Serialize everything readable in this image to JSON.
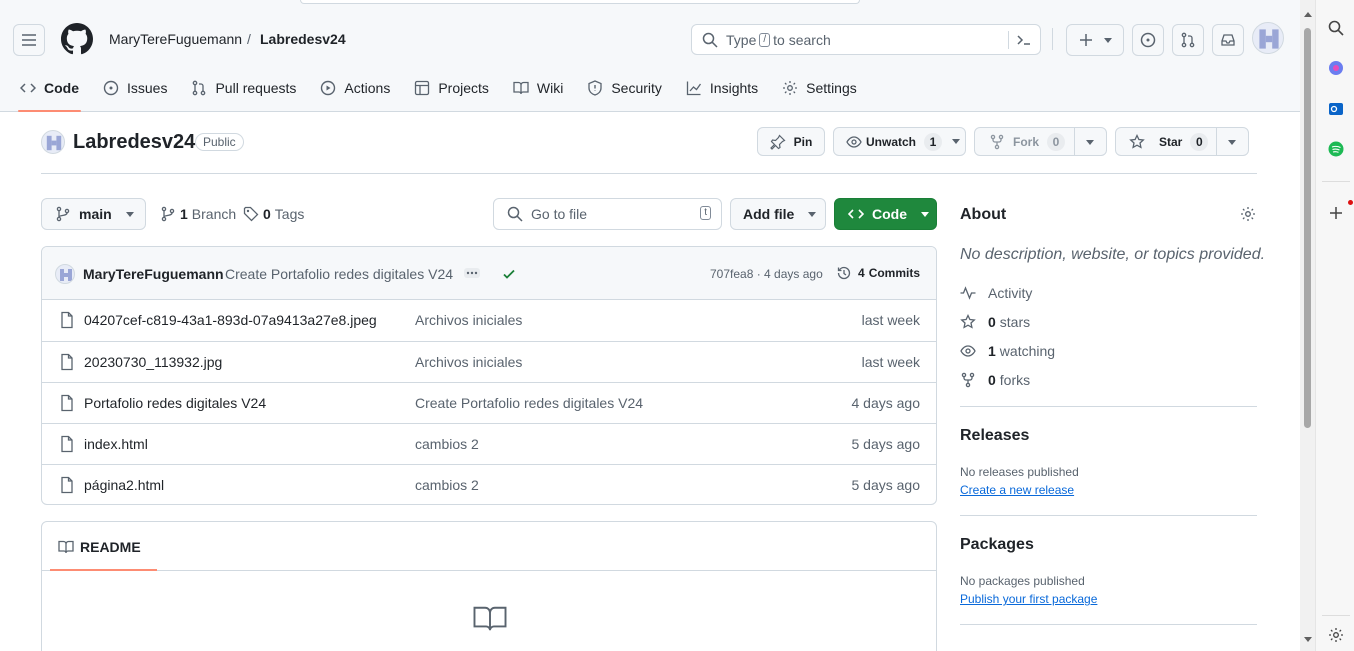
{
  "breadcrumb": {
    "owner": "MaryTereFuguemann",
    "separator": "/",
    "repo": "Labredesv24"
  },
  "search": {
    "type": "Type",
    "key": "/",
    "rest": "to search"
  },
  "nav": [
    {
      "label": "Code",
      "icon": "code-icon",
      "active": true
    },
    {
      "label": "Issues",
      "icon": "issue-icon"
    },
    {
      "label": "Pull requests",
      "icon": "pull-request-icon"
    },
    {
      "label": "Actions",
      "icon": "play-icon"
    },
    {
      "label": "Projects",
      "icon": "table-icon"
    },
    {
      "label": "Wiki",
      "icon": "book-icon"
    },
    {
      "label": "Security",
      "icon": "shield-icon"
    },
    {
      "label": "Insights",
      "icon": "graph-icon"
    },
    {
      "label": "Settings",
      "icon": "gear-icon"
    }
  ],
  "repo": {
    "name": "Labredesv24",
    "visibility": "Public",
    "pin": "Pin",
    "unwatch": "Unwatch",
    "watch_count": "1",
    "fork": "Fork",
    "fork_count": "0",
    "star": "Star",
    "star_count": "0"
  },
  "toolbar": {
    "branch": "main",
    "branches_count": "1",
    "branches_label": "Branch",
    "tags_count": "0",
    "tags_label": "Tags",
    "goto_placeholder": "Go to file",
    "goto_key": "t",
    "add_file": "Add file",
    "code": "Code"
  },
  "commit": {
    "author": "MaryTereFuguemann",
    "message": "Create Portafolio redes digitales V24",
    "sha_time": "707fea8 · 4 days ago",
    "commits_count": "4",
    "commits_label": "Commits"
  },
  "files": [
    {
      "name": "04207cef-c819-43a1-893d-07a9413a27e8.jpeg",
      "message": "Archivos iniciales",
      "date": "last week"
    },
    {
      "name": "20230730_113932.jpg",
      "message": "Archivos iniciales",
      "date": "last week"
    },
    {
      "name": "Portafolio redes digitales V24",
      "message": "Create Portafolio redes digitales V24",
      "date": "4 days ago"
    },
    {
      "name": "index.html",
      "message": "cambios 2",
      "date": "5 days ago"
    },
    {
      "name": "página2.html",
      "message": "cambios 2",
      "date": "5 days ago"
    }
  ],
  "readme": {
    "tab": "README"
  },
  "about": {
    "title": "About",
    "description": "No description, website, or topics provided.",
    "activity": "Activity",
    "stars_count": "0",
    "stars_label": "stars",
    "watching_count": "1",
    "watching_label": "watching",
    "forks_count": "0",
    "forks_label": "forks"
  },
  "releases": {
    "title": "Releases",
    "none": "No releases published",
    "link": "Create a new release"
  },
  "packages": {
    "title": "Packages",
    "none": "No packages published",
    "link": "Publish your first package"
  },
  "colors": {
    "accent_underline": "#fd8c73",
    "code_button": "#1f883d",
    "link": "#0969da",
    "check": "#1a7f37"
  }
}
